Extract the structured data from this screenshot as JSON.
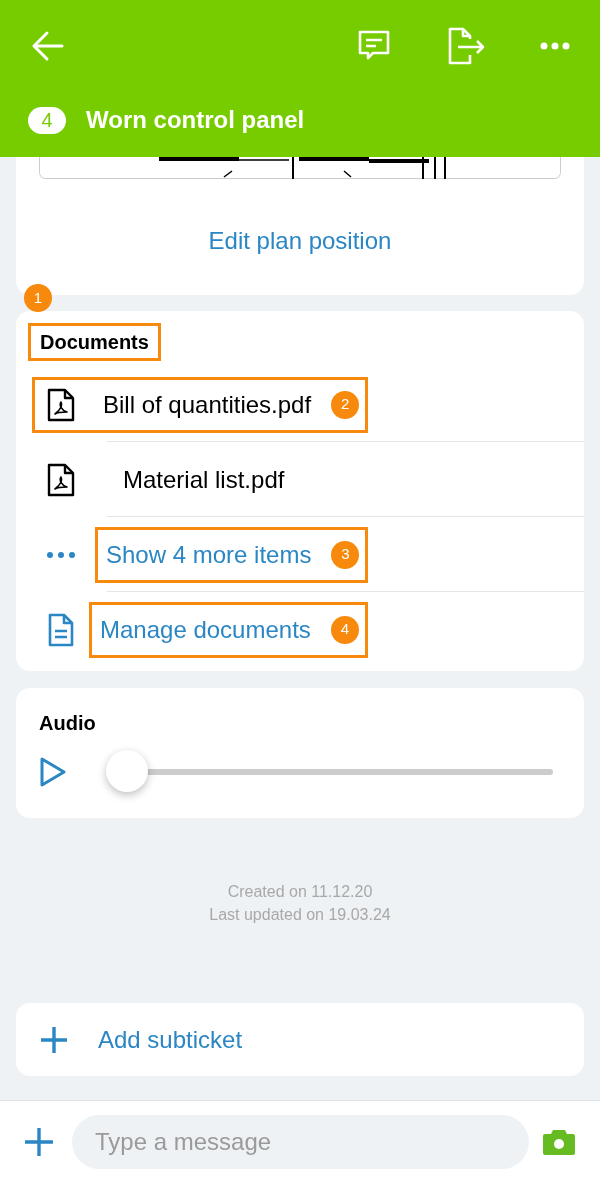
{
  "header": {
    "ticket_number": "4",
    "title": "Worn control panel"
  },
  "plan": {
    "link": "Edit plan position"
  },
  "documents": {
    "title": "Documents",
    "title_callout": "1",
    "items": [
      {
        "kind": "file",
        "label": "Bill of quantities.pdf",
        "callout": "2"
      },
      {
        "kind": "file",
        "label": "Material list.pdf"
      },
      {
        "kind": "more",
        "label": "Show 4 more items",
        "callout": "3"
      },
      {
        "kind": "manage",
        "label": "Manage documents",
        "callout": "4"
      }
    ]
  },
  "audio": {
    "title": "Audio",
    "level": 0
  },
  "meta": [
    "Created on 11.12.20",
    "Last updated on 19.03.24"
  ],
  "add_subticket": "Add subticket",
  "composer": {
    "placeholder": "Type a message"
  }
}
